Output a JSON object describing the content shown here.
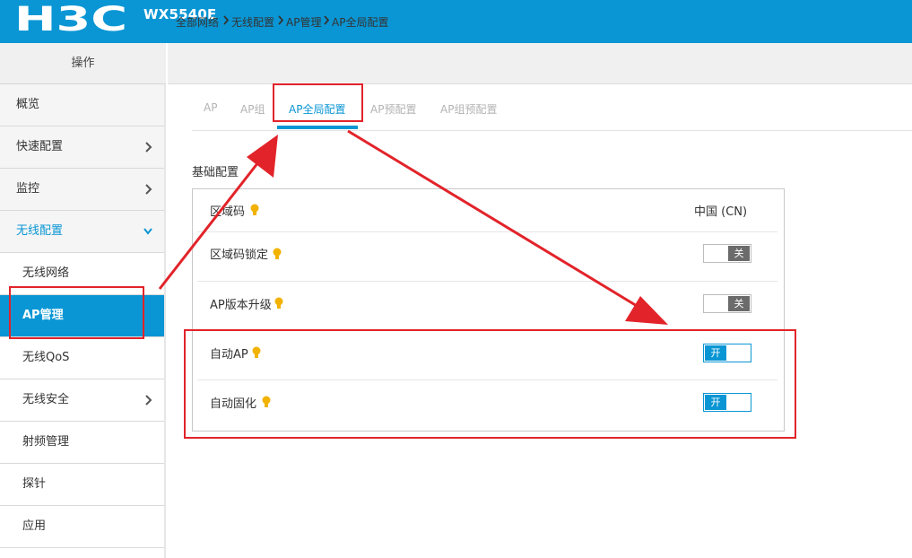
{
  "header": {
    "logo_text": "H3C",
    "model": "WX5540E",
    "color": "#0a96d4"
  },
  "sidebar": {
    "heading": "操作",
    "items": [
      {
        "label": "概览",
        "icon": "none"
      },
      {
        "label": "快速配置",
        "icon": "chevron-right-icon"
      },
      {
        "label": "监控",
        "icon": "chevron-right-icon"
      },
      {
        "label": "无线配置",
        "icon": "chevron-down-icon"
      },
      {
        "label": "无线网络",
        "icon": "none"
      },
      {
        "label": "AP管理",
        "icon": "none"
      },
      {
        "label": "无线QoS",
        "icon": "none"
      },
      {
        "label": "无线安全",
        "icon": "chevron-right-icon"
      },
      {
        "label": "射频管理",
        "icon": "none"
      },
      {
        "label": "探针",
        "icon": "none"
      },
      {
        "label": "应用",
        "icon": "none"
      }
    ]
  },
  "breadcrumb": [
    "全部网络",
    "无线配置",
    "AP管理",
    "AP全局配置"
  ],
  "tabs": [
    "AP",
    "AP组",
    "AP全局配置",
    "AP预配置",
    "AP组预配置"
  ],
  "section": {
    "title": "基础配置",
    "rows": [
      {
        "label": "区域码",
        "value": "中国 (CN)"
      },
      {
        "label": "区域码锁定",
        "toggle": "关"
      },
      {
        "label": "AP版本升级",
        "toggle": "关"
      },
      {
        "label": "自动AP",
        "toggle": "开"
      },
      {
        "label": "自动固化",
        "toggle": "开"
      }
    ]
  },
  "colors": {
    "accent": "#0a96d4",
    "annotation": "#e2232a",
    "bulb": "#f2b200"
  }
}
